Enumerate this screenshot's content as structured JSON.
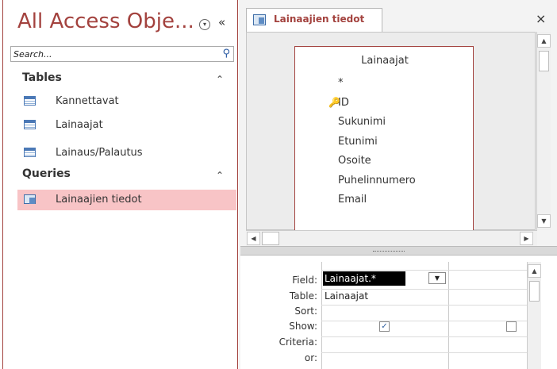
{
  "nav": {
    "title": "All Access Obje...",
    "menu_glyph": "▾",
    "collapse_glyph": "«",
    "search_placeholder": "Search...",
    "groups": [
      {
        "label": "Tables",
        "toggle_glyph": "⌃",
        "items": [
          {
            "label": "Kannettavat",
            "icon": "table-icon"
          },
          {
            "label": "Lainaajat",
            "icon": "table-icon"
          },
          {
            "label": "Lainaus/Palautus",
            "icon": "table-icon"
          }
        ]
      },
      {
        "label": "Queries",
        "toggle_glyph": "⌃",
        "items": [
          {
            "label": "Lainaajien tiedot",
            "icon": "query-icon",
            "selected": true
          }
        ]
      }
    ]
  },
  "document": {
    "tab_label": "Lainaajien tiedot",
    "close_glyph": "×",
    "table_box": {
      "title": "Lainaajat",
      "fields": [
        {
          "name": "*",
          "primary_key": false
        },
        {
          "name": "ID",
          "primary_key": true
        },
        {
          "name": "Sukunimi",
          "primary_key": false
        },
        {
          "name": "Etunimi",
          "primary_key": false
        },
        {
          "name": "Osoite",
          "primary_key": false
        },
        {
          "name": "Puhelinnumero",
          "primary_key": false
        },
        {
          "name": "Email",
          "primary_key": false
        }
      ]
    },
    "grid": {
      "row_labels": [
        "Field:",
        "Table:",
        "Sort:",
        "Show:",
        "Criteria:",
        "or:"
      ],
      "columns": [
        {
          "field": "Lainaajat.*",
          "table": "Lainaajat",
          "sort": "",
          "show": true
        },
        {
          "field": "",
          "table": "",
          "sort": "",
          "show": false
        }
      ]
    }
  },
  "colors": {
    "accent": "#a3423e",
    "selected_item_bg": "#f8c4c6",
    "design_bg": "#ececec"
  }
}
